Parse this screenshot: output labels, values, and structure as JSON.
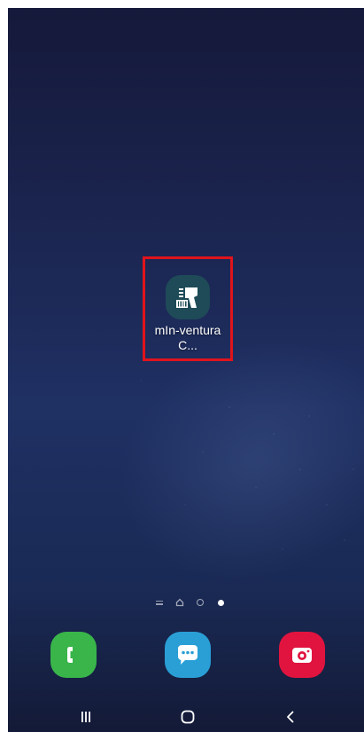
{
  "home_screen": {
    "app": {
      "label": "mIn-ventura C...",
      "icon": "barcode-scanner-icon",
      "icon_bg": "#1e4b57",
      "highlight_color": "#e0141c"
    },
    "page_indicator": {
      "pages": [
        "lines",
        "home",
        "page",
        "current"
      ],
      "current_page": 4
    }
  },
  "dock": {
    "items": [
      {
        "name": "phone",
        "icon": "phone-icon",
        "color": "#39b54a"
      },
      {
        "name": "messages",
        "icon": "messages-icon",
        "color": "#2a9fd6"
      },
      {
        "name": "camera",
        "icon": "camera-icon",
        "color": "#e0143f"
      }
    ]
  },
  "navigation_bar": {
    "buttons": [
      "recents-icon",
      "home-icon",
      "back-icon"
    ]
  }
}
